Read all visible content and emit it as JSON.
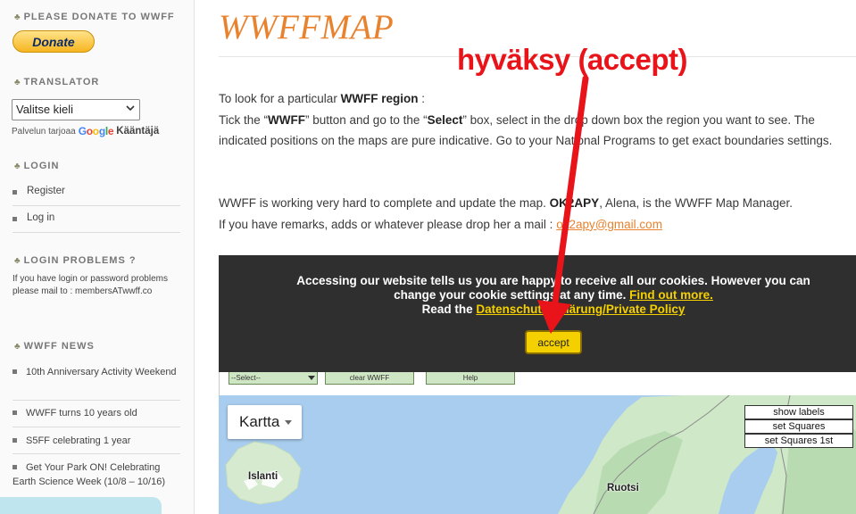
{
  "sidebar": {
    "donate_heading": "PLEASE DONATE TO WWFF",
    "donate_button": "Donate",
    "translator_heading": "TRANSLATOR",
    "language_select": "Valitse kieli",
    "powered_by": "Palvelun tarjoaa",
    "google": "Google",
    "translate": "Kääntäjä",
    "login_heading": "LOGIN",
    "login_links": [
      "Register",
      "Log in"
    ],
    "login_problems_heading": "LOGIN PROBLEMS ?",
    "login_problems_text": "If you have login or password problems please mail to : membersATwwff.co",
    "news_heading": "WWFF NEWS",
    "news_items": [
      "10th Anniversary Activity Weekend",
      "WWFF turns 10 years old",
      "S5FF celebrating 1 year",
      "Get Your Park ON! Celebrating Earth Science Week (10/8 – 10/16)"
    ]
  },
  "main": {
    "title": "WWFFMAP",
    "p1_intro": "To look for a particular ",
    "p1_region": "WWFF region",
    "p1_colon": " :",
    "p2_a": "Tick the “",
    "p2_wwff": "WWFF",
    "p2_b": "” button and go to the “",
    "p2_select": "Select",
    "p2_c": "” box, select in the drop down box the region you want to see. The indicated positions on the maps are pure indicative. Go to your  National Programs to get exact boundaries settings.",
    "p3_a": "WWFF is working very hard to complete and update the map. ",
    "p3_name": "OK2APY",
    "p3_b": ", Alena, is the WWFF Map Manager.",
    "p3_c": "If you have remarks, adds or whatever please drop her a mail : ",
    "p3_mail": "ok2apy@gmail.com "
  },
  "cookie": {
    "line1": "Accessing our website tells us you are happy to receive all our cookies. However you can",
    "line2": "change your cookie settings at any time. ",
    "find_out": "Find out more.",
    "line3": "Read the ",
    "policy": "Datenschutzerklärung/Private Policy",
    "accept": "accept"
  },
  "map_toolbar": {
    "select": "--Select--",
    "clear": "clear WWFF",
    "help": "Help"
  },
  "map": {
    "type_button": "Kartta",
    "labels": [
      "Islanti",
      "Ruotsi"
    ],
    "controls": [
      "show labels",
      "set Squares",
      "set Squares 1st"
    ],
    "colors": {
      "water": "#a8cdee",
      "land": "#cfe8c8",
      "forest": "#b9dbb1"
    }
  },
  "annotation": {
    "text": "hyväksy (accept)",
    "color": "#e8141a"
  }
}
